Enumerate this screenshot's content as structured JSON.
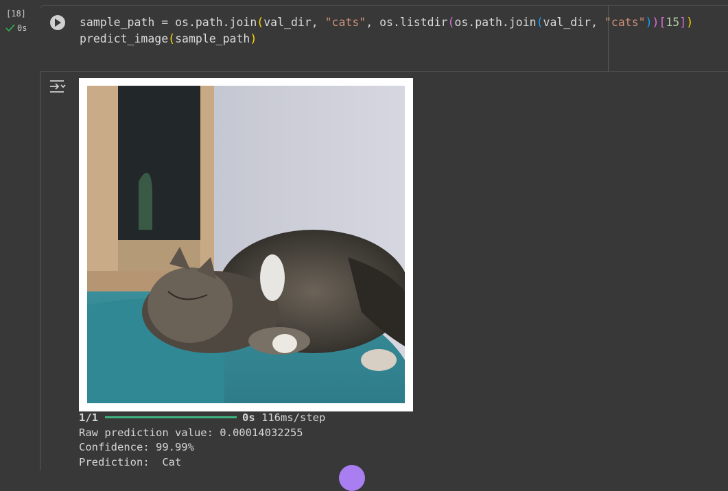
{
  "cell": {
    "execution_count": "[18]",
    "status_time": "0s",
    "code_lines": [
      "sample_path = os.path.join(val_dir, \"cats\", os.listdir(os.path.join(val_dir, \"cats\"))[15])",
      "predict_image(sample_path)"
    ]
  },
  "output": {
    "progress_step": "1/1",
    "progress_fraction": 1.0,
    "progress_time": "0s",
    "progress_rate": "116ms/step",
    "raw_line": "Raw prediction value: 0.00014032255",
    "confidence_line": "Confidence: 99.99%",
    "prediction_line": "Prediction:  Cat"
  },
  "colors": {
    "progress_bar": "#3fb27f",
    "string": "#ce9178",
    "bracket_level1": "#ffd700",
    "bracket_level2": "#da70d6",
    "bracket_level3": "#179fff",
    "status_check": "#34a853"
  },
  "icons": [
    "run-icon",
    "check-icon",
    "output-toggle-icon"
  ]
}
